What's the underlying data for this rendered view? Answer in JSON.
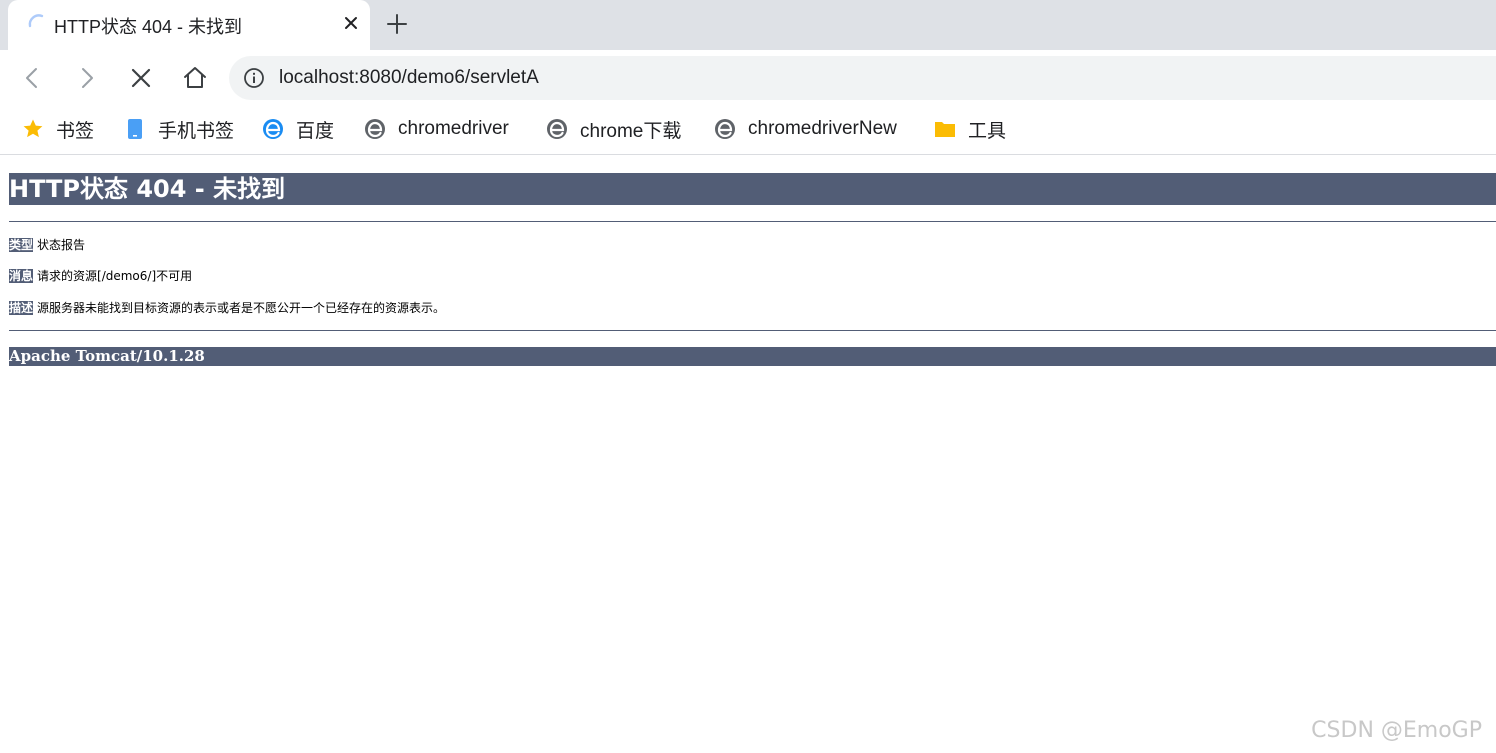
{
  "tab": {
    "title": "HTTP状态 404 - 未找到",
    "close_icon": "close-icon",
    "loading_icon": "loading-spinner-icon"
  },
  "new_tab_icon": "plus-icon",
  "toolbar": {
    "back_icon": "arrow-left-icon",
    "forward_icon": "arrow-right-icon",
    "stop_icon": "close-icon",
    "home_icon": "home-icon"
  },
  "address_bar": {
    "url": "localhost:8080/demo6/servletA",
    "site_info_icon": "info-icon"
  },
  "bookmarks": [
    {
      "label": "书签",
      "icon": "star-icon",
      "color": "#fbbc04"
    },
    {
      "label": "手机书签",
      "icon": "mobile-icon",
      "color": "#4a9ff5"
    },
    {
      "label": "百度",
      "icon": "browser-e-icon",
      "color": "#1a8cf2"
    },
    {
      "label": "chromedriver",
      "icon": "browser-e-icon",
      "color": "#5f6368"
    },
    {
      "label": "chrome下载",
      "icon": "browser-e-icon",
      "color": "#5f6368"
    },
    {
      "label": "chromedriverNew",
      "icon": "browser-e-icon",
      "color": "#5f6368"
    },
    {
      "label": "工具",
      "icon": "folder-icon",
      "color": "#fbbc04"
    }
  ],
  "page": {
    "heading": "HTTP状态 404 - 未找到",
    "type_label": "类型",
    "type_value": "状态报告",
    "message_label": "消息",
    "message_value": "请求的资源[/demo6/]不可用",
    "description_label": "描述",
    "description_value": "源服务器未能找到目标资源的表示或者是不愿公开一个已经存在的资源表示。",
    "footer": "Apache Tomcat/10.1.28",
    "accent_color": "#525d76"
  },
  "watermark": "CSDN @EmoGP"
}
